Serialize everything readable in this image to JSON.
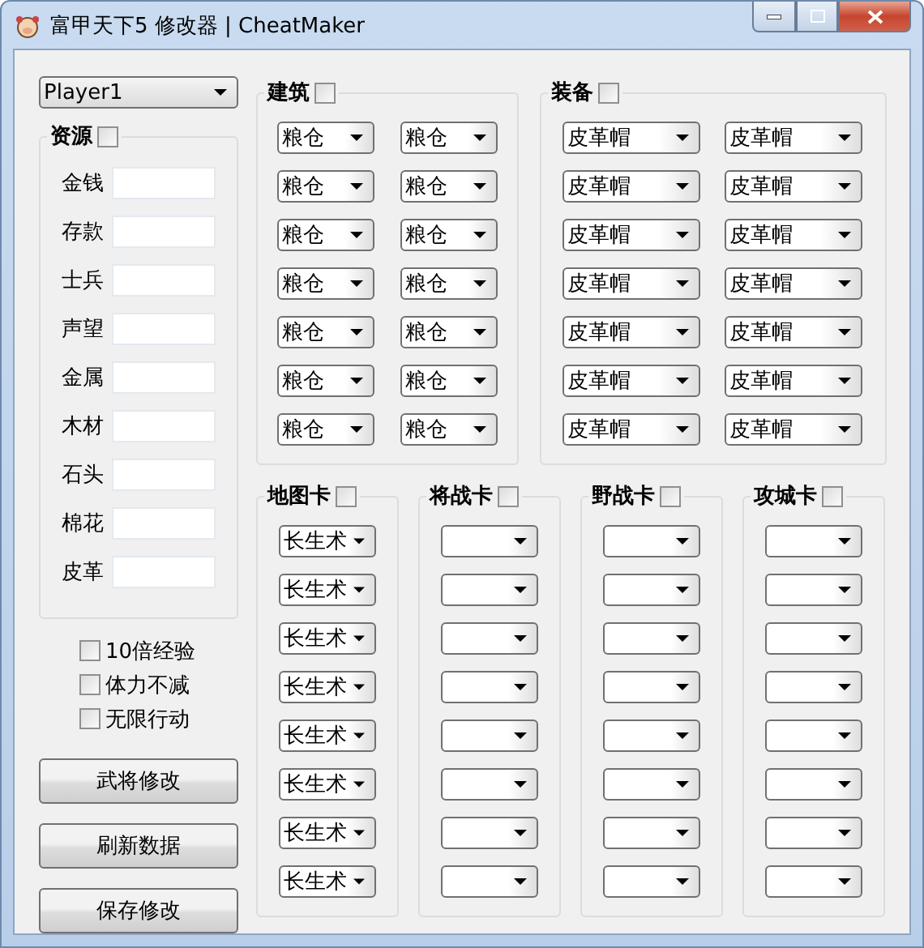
{
  "window": {
    "title": "富甲天下5 修改器 | CheatMaker"
  },
  "player_select": {
    "value": "Player1"
  },
  "resources": {
    "label": "资源",
    "checked": false,
    "fields": [
      {
        "label": "金钱"
      },
      {
        "label": "存款"
      },
      {
        "label": "士兵"
      },
      {
        "label": "声望"
      },
      {
        "label": "金属"
      },
      {
        "label": "木材"
      },
      {
        "label": "石头"
      },
      {
        "label": "棉花"
      },
      {
        "label": "皮革"
      }
    ]
  },
  "options": [
    {
      "label": "10倍经验",
      "checked": false
    },
    {
      "label": "体力不减",
      "checked": false
    },
    {
      "label": "无限行动",
      "checked": false
    }
  ],
  "buttons": [
    "武将修改",
    "刷新数据",
    "保存修改"
  ],
  "top_groups": [
    {
      "label": "建筑",
      "checked": false,
      "combos": [
        {
          "kind": "filled",
          "value": "粮仓"
        },
        {
          "kind": "filled",
          "value": "粮仓"
        },
        {
          "kind": "filled",
          "value": "粮仓"
        },
        {
          "kind": "filled",
          "value": "粮仓"
        },
        {
          "kind": "filled",
          "value": "粮仓"
        },
        {
          "kind": "filled",
          "value": "粮仓"
        },
        {
          "kind": "filled",
          "value": "粮仓"
        },
        {
          "kind": "filled",
          "value": "粮仓"
        },
        {
          "kind": "filled",
          "value": "粮仓"
        },
        {
          "kind": "filled",
          "value": "粮仓"
        },
        {
          "kind": "filled",
          "value": "粮仓"
        },
        {
          "kind": "filled",
          "value": "粮仓"
        },
        {
          "kind": "filled",
          "value": "粮仓"
        },
        {
          "kind": "filled",
          "value": "粮仓"
        }
      ]
    },
    {
      "label": "装备",
      "checked": false,
      "combos": [
        {
          "kind": "filled",
          "value": "皮革帽"
        },
        {
          "kind": "filled",
          "value": "皮革帽"
        },
        {
          "kind": "filled",
          "value": "皮革帽"
        },
        {
          "kind": "filled",
          "value": "皮革帽"
        },
        {
          "kind": "filled",
          "value": "皮革帽"
        },
        {
          "kind": "filled",
          "value": "皮革帽"
        },
        {
          "kind": "filled",
          "value": "皮革帽"
        },
        {
          "kind": "filled",
          "value": "皮革帽"
        },
        {
          "kind": "filled",
          "value": "皮革帽"
        },
        {
          "kind": "filled",
          "value": "皮革帽"
        },
        {
          "kind": "filled",
          "value": "皮革帽"
        },
        {
          "kind": "filled",
          "value": "皮革帽"
        },
        {
          "kind": "filled",
          "value": "皮革帽"
        },
        {
          "kind": "filled",
          "value": "皮革帽"
        }
      ]
    }
  ],
  "card_groups": [
    {
      "label": "地图卡",
      "checked": false,
      "combos": [
        {
          "kind": "filled",
          "value": "长生术"
        },
        {
          "kind": "filled",
          "value": "长生术"
        },
        {
          "kind": "filled",
          "value": "长生术"
        },
        {
          "kind": "filled",
          "value": "长生术"
        },
        {
          "kind": "filled",
          "value": "长生术"
        },
        {
          "kind": "filled",
          "value": "长生术"
        },
        {
          "kind": "filled",
          "value": "长生术"
        },
        {
          "kind": "filled",
          "value": "长生术"
        }
      ]
    },
    {
      "label": "将战卡",
      "checked": false,
      "combos": [
        {
          "kind": "blank"
        },
        {
          "kind": "blank"
        },
        {
          "kind": "blank"
        },
        {
          "kind": "blank"
        },
        {
          "kind": "blank"
        },
        {
          "kind": "blank"
        },
        {
          "kind": "blank"
        },
        {
          "kind": "blank"
        }
      ]
    },
    {
      "label": "野战卡",
      "checked": false,
      "combos": [
        {
          "kind": "blank"
        },
        {
          "kind": "blank"
        },
        {
          "kind": "blank"
        },
        {
          "kind": "blank"
        },
        {
          "kind": "blank"
        },
        {
          "kind": "blank"
        },
        {
          "kind": "blank"
        },
        {
          "kind": "blank"
        }
      ]
    },
    {
      "label": "攻城卡",
      "checked": false,
      "combos": [
        {
          "kind": "blank"
        },
        {
          "kind": "blank"
        },
        {
          "kind": "blank"
        },
        {
          "kind": "blank"
        },
        {
          "kind": "blank"
        },
        {
          "kind": "blank"
        },
        {
          "kind": "blank"
        },
        {
          "kind": "blank"
        }
      ]
    }
  ]
}
